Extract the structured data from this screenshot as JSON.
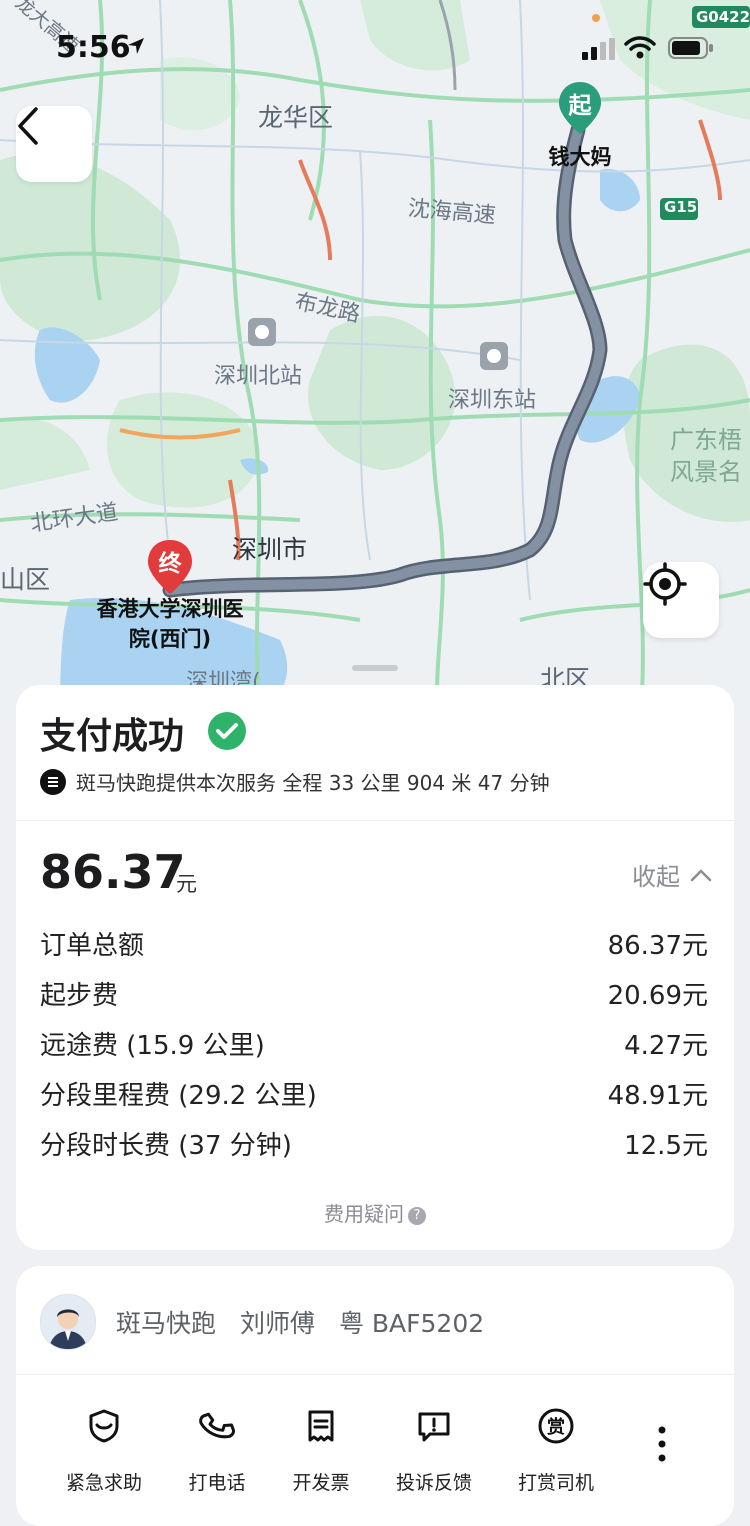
{
  "status_bar": {
    "time": "5:56"
  },
  "map": {
    "labels": {
      "longhua": "龙华区",
      "shenhai": "沈海高速",
      "bulong": "布龙路",
      "sz_north": "深圳北站",
      "sz_east": "深圳东站",
      "beihuan": "北环大道",
      "shenzhen": "深圳市",
      "shanqu": "山区",
      "shenzhenwan": "深圳湾(",
      "beiqu": "北区",
      "guangdong": "广东梧",
      "fengjing": "风景名",
      "g15": "G15",
      "g0422": "G0422",
      "longda": "龙大高速"
    },
    "start": {
      "badge": "起",
      "name": "钱大妈"
    },
    "end": {
      "badge": "终",
      "name_line1": "香港大学深圳医",
      "name_line2": "院(西门)"
    }
  },
  "payment": {
    "title": "支付成功",
    "service_line": "斑马快跑提供本次服务 全程 33 公里 904 米 47 分钟",
    "amount": "86.37",
    "amount_unit": "元",
    "collapse_label": "收起",
    "fees": [
      {
        "label": "订单总额",
        "value": "86.37元"
      },
      {
        "label": "起步费",
        "value": "20.69元"
      },
      {
        "label": "远途费 (15.9 公里)",
        "value": "4.27元"
      },
      {
        "label": "分段里程费 (29.2 公里)",
        "value": "48.91元"
      },
      {
        "label": "分段时长费 (37 分钟)",
        "value": "12.5元"
      }
    ],
    "question_label": "费用疑问",
    "question_mark": "?"
  },
  "driver": {
    "company": "斑马快跑",
    "name": "刘师傅",
    "plate": "粤 BAF5202"
  },
  "actions": [
    {
      "label": "紧急求助",
      "icon": "shield-icon"
    },
    {
      "label": "打电话",
      "icon": "phone-icon"
    },
    {
      "label": "开发票",
      "icon": "invoice-icon"
    },
    {
      "label": "投诉反馈",
      "icon": "complaint-icon"
    },
    {
      "label": "打赏司机",
      "icon": "tip-icon"
    }
  ],
  "colors": {
    "accent_green": "#2fb36b",
    "start_pin": "#2a9d7a",
    "end_pin": "#e23b3b",
    "route": "#7d8a99"
  }
}
